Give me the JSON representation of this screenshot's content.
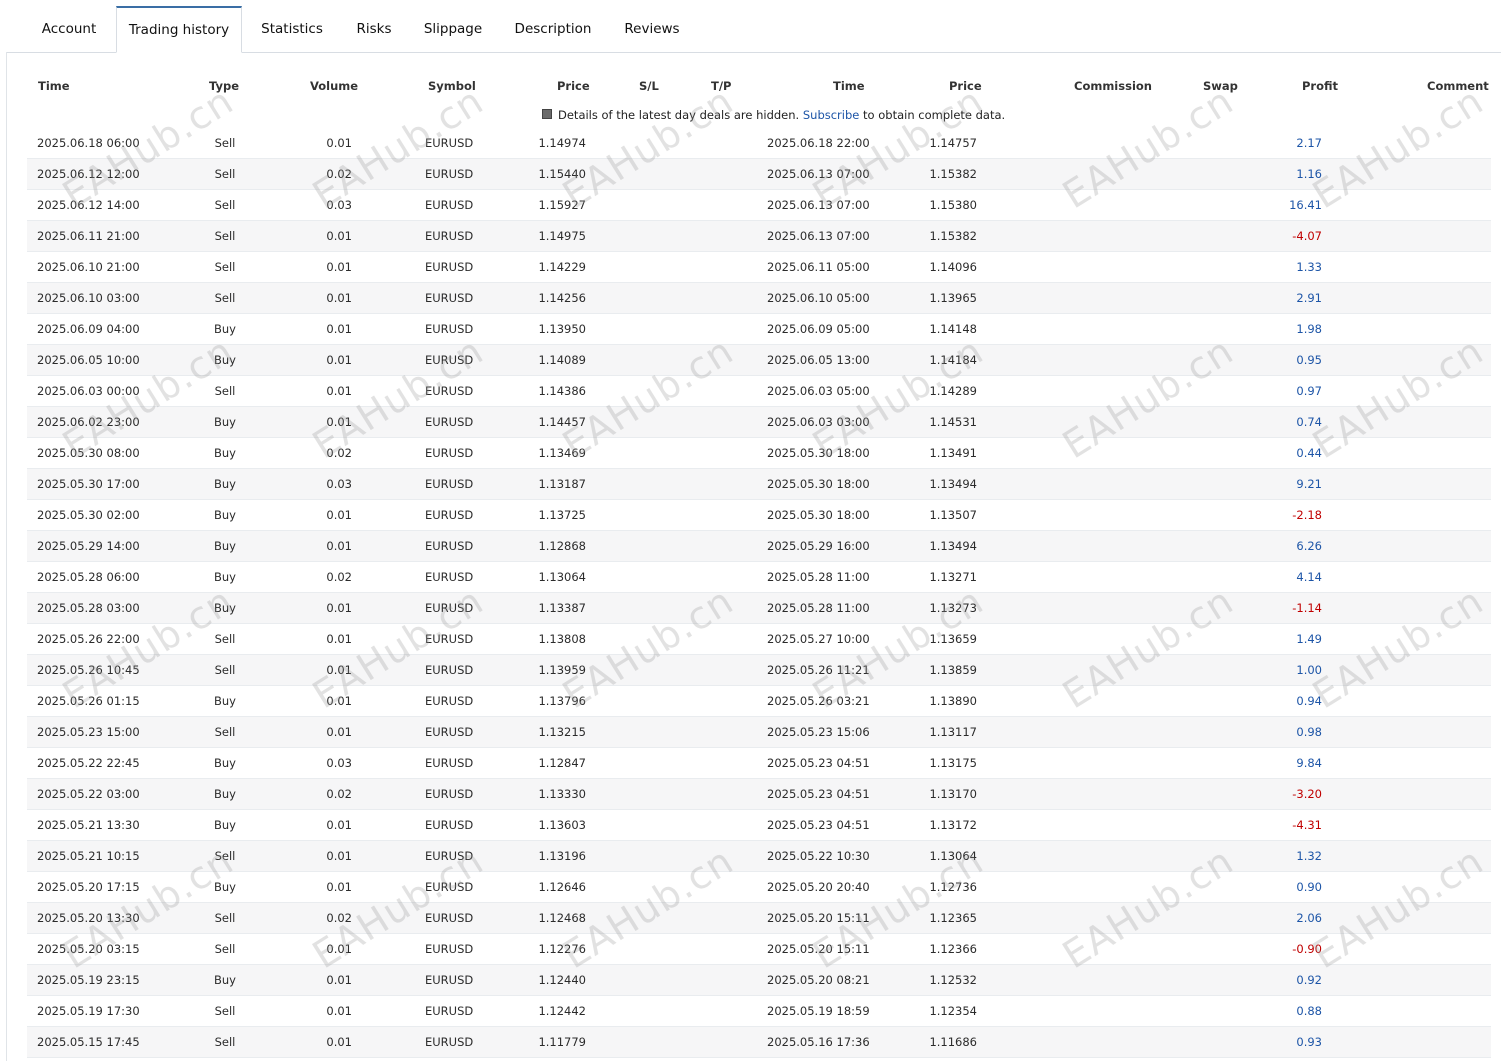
{
  "tabs": [
    {
      "label": "Account",
      "active": false
    },
    {
      "label": "Trading history",
      "active": true
    },
    {
      "label": "Statistics",
      "active": false
    },
    {
      "label": "Risks",
      "active": false
    },
    {
      "label": "Slippage",
      "active": false
    },
    {
      "label": "Description",
      "active": false
    },
    {
      "label": "Reviews",
      "active": false
    }
  ],
  "columns": {
    "time": "Time",
    "type": "Type",
    "volume": "Volume",
    "symbol": "Symbol",
    "price": "Price",
    "sl": "S/L",
    "tp": "T/P",
    "close_time": "Time",
    "close_price": "Price",
    "commission": "Commission",
    "swap": "Swap",
    "profit": "Profit",
    "comment": "Comment"
  },
  "notice": {
    "before": "Details of the latest day deals are hidden.",
    "link": "Subscribe",
    "after": "to obtain complete data."
  },
  "watermark": "EAHub.cn",
  "colors": {
    "positive": "#1d55a7",
    "negative": "#c00000",
    "tab_accent": "#3a6ea5"
  },
  "trades": [
    [
      "2025.06.18 06:00",
      "Sell",
      "0.01",
      "EURUSD",
      "1.14974",
      "2025.06.18 22:00",
      "1.14757",
      "2.17"
    ],
    [
      "2025.06.12 12:00",
      "Sell",
      "0.02",
      "EURUSD",
      "1.15440",
      "2025.06.13 07:00",
      "1.15382",
      "1.16"
    ],
    [
      "2025.06.12 14:00",
      "Sell",
      "0.03",
      "EURUSD",
      "1.15927",
      "2025.06.13 07:00",
      "1.15380",
      "16.41"
    ],
    [
      "2025.06.11 21:00",
      "Sell",
      "0.01",
      "EURUSD",
      "1.14975",
      "2025.06.13 07:00",
      "1.15382",
      "-4.07"
    ],
    [
      "2025.06.10 21:00",
      "Sell",
      "0.01",
      "EURUSD",
      "1.14229",
      "2025.06.11 05:00",
      "1.14096",
      "1.33"
    ],
    [
      "2025.06.10 03:00",
      "Sell",
      "0.01",
      "EURUSD",
      "1.14256",
      "2025.06.10 05:00",
      "1.13965",
      "2.91"
    ],
    [
      "2025.06.09 04:00",
      "Buy",
      "0.01",
      "EURUSD",
      "1.13950",
      "2025.06.09 05:00",
      "1.14148",
      "1.98"
    ],
    [
      "2025.06.05 10:00",
      "Buy",
      "0.01",
      "EURUSD",
      "1.14089",
      "2025.06.05 13:00",
      "1.14184",
      "0.95"
    ],
    [
      "2025.06.03 00:00",
      "Sell",
      "0.01",
      "EURUSD",
      "1.14386",
      "2025.06.03 05:00",
      "1.14289",
      "0.97"
    ],
    [
      "2025.06.02 23:00",
      "Buy",
      "0.01",
      "EURUSD",
      "1.14457",
      "2025.06.03 03:00",
      "1.14531",
      "0.74"
    ],
    [
      "2025.05.30 08:00",
      "Buy",
      "0.02",
      "EURUSD",
      "1.13469",
      "2025.05.30 18:00",
      "1.13491",
      "0.44"
    ],
    [
      "2025.05.30 17:00",
      "Buy",
      "0.03",
      "EURUSD",
      "1.13187",
      "2025.05.30 18:00",
      "1.13494",
      "9.21"
    ],
    [
      "2025.05.30 02:00",
      "Buy",
      "0.01",
      "EURUSD",
      "1.13725",
      "2025.05.30 18:00",
      "1.13507",
      "-2.18"
    ],
    [
      "2025.05.29 14:00",
      "Buy",
      "0.01",
      "EURUSD",
      "1.12868",
      "2025.05.29 16:00",
      "1.13494",
      "6.26"
    ],
    [
      "2025.05.28 06:00",
      "Buy",
      "0.02",
      "EURUSD",
      "1.13064",
      "2025.05.28 11:00",
      "1.13271",
      "4.14"
    ],
    [
      "2025.05.28 03:00",
      "Buy",
      "0.01",
      "EURUSD",
      "1.13387",
      "2025.05.28 11:00",
      "1.13273",
      "-1.14"
    ],
    [
      "2025.05.26 22:00",
      "Sell",
      "0.01",
      "EURUSD",
      "1.13808",
      "2025.05.27 10:00",
      "1.13659",
      "1.49"
    ],
    [
      "2025.05.26 10:45",
      "Sell",
      "0.01",
      "EURUSD",
      "1.13959",
      "2025.05.26 11:21",
      "1.13859",
      "1.00"
    ],
    [
      "2025.05.26 01:15",
      "Buy",
      "0.01",
      "EURUSD",
      "1.13796",
      "2025.05.26 03:21",
      "1.13890",
      "0.94"
    ],
    [
      "2025.05.23 15:00",
      "Sell",
      "0.01",
      "EURUSD",
      "1.13215",
      "2025.05.23 15:06",
      "1.13117",
      "0.98"
    ],
    [
      "2025.05.22 22:45",
      "Buy",
      "0.03",
      "EURUSD",
      "1.12847",
      "2025.05.23 04:51",
      "1.13175",
      "9.84"
    ],
    [
      "2025.05.22 03:00",
      "Buy",
      "0.02",
      "EURUSD",
      "1.13330",
      "2025.05.23 04:51",
      "1.13170",
      "-3.20"
    ],
    [
      "2025.05.21 13:30",
      "Buy",
      "0.01",
      "EURUSD",
      "1.13603",
      "2025.05.23 04:51",
      "1.13172",
      "-4.31"
    ],
    [
      "2025.05.21 10:15",
      "Sell",
      "0.01",
      "EURUSD",
      "1.13196",
      "2025.05.22 10:30",
      "1.13064",
      "1.32"
    ],
    [
      "2025.05.20 17:15",
      "Buy",
      "0.01",
      "EURUSD",
      "1.12646",
      "2025.05.20 20:40",
      "1.12736",
      "0.90"
    ],
    [
      "2025.05.20 13:30",
      "Sell",
      "0.02",
      "EURUSD",
      "1.12468",
      "2025.05.20 15:11",
      "1.12365",
      "2.06"
    ],
    [
      "2025.05.20 03:15",
      "Sell",
      "0.01",
      "EURUSD",
      "1.12276",
      "2025.05.20 15:11",
      "1.12366",
      "-0.90"
    ],
    [
      "2025.05.19 23:15",
      "Buy",
      "0.01",
      "EURUSD",
      "1.12440",
      "2025.05.20 08:21",
      "1.12532",
      "0.92"
    ],
    [
      "2025.05.19 17:30",
      "Sell",
      "0.01",
      "EURUSD",
      "1.12442",
      "2025.05.19 18:59",
      "1.12354",
      "0.88"
    ],
    [
      "2025.05.15 17:45",
      "Sell",
      "0.01",
      "EURUSD",
      "1.11779",
      "2025.05.16 17:36",
      "1.11686",
      "0.93"
    ]
  ]
}
